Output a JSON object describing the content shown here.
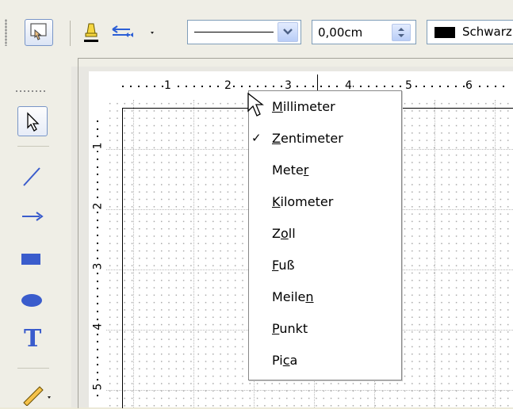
{
  "toolbar": {
    "line_style_value": "",
    "line_width_value": "0,00cm",
    "line_color_value": "Schwarz",
    "line_color_swatch": "#000000"
  },
  "left_toolbar": {
    "tools": [
      "select",
      "line",
      "line-arrow",
      "rectangle",
      "ellipse",
      "text",
      "pen"
    ]
  },
  "ruler": {
    "horizontal_ticks": [
      "1",
      "2",
      "3",
      "4",
      "5",
      "6"
    ],
    "vertical_ticks": [
      "1",
      "2",
      "3",
      "4",
      "5"
    ]
  },
  "menu": {
    "items": [
      {
        "label": "Millimeter",
        "checked": false
      },
      {
        "label": "Zentimeter",
        "checked": true
      },
      {
        "label": "Meter",
        "checked": false
      },
      {
        "label": "Kilometer",
        "checked": false
      },
      {
        "label": "Zoll",
        "checked": false
      },
      {
        "label": "Fuß",
        "checked": false
      },
      {
        "label": "Meilen",
        "checked": false
      },
      {
        "label": "Punkt",
        "checked": false
      },
      {
        "label": "Pica",
        "checked": false
      }
    ],
    "check_mark": "✓"
  },
  "colors": {
    "accent": "#7895c7",
    "grid": "#b8b8b8",
    "tool_blue": "#3355cc"
  }
}
